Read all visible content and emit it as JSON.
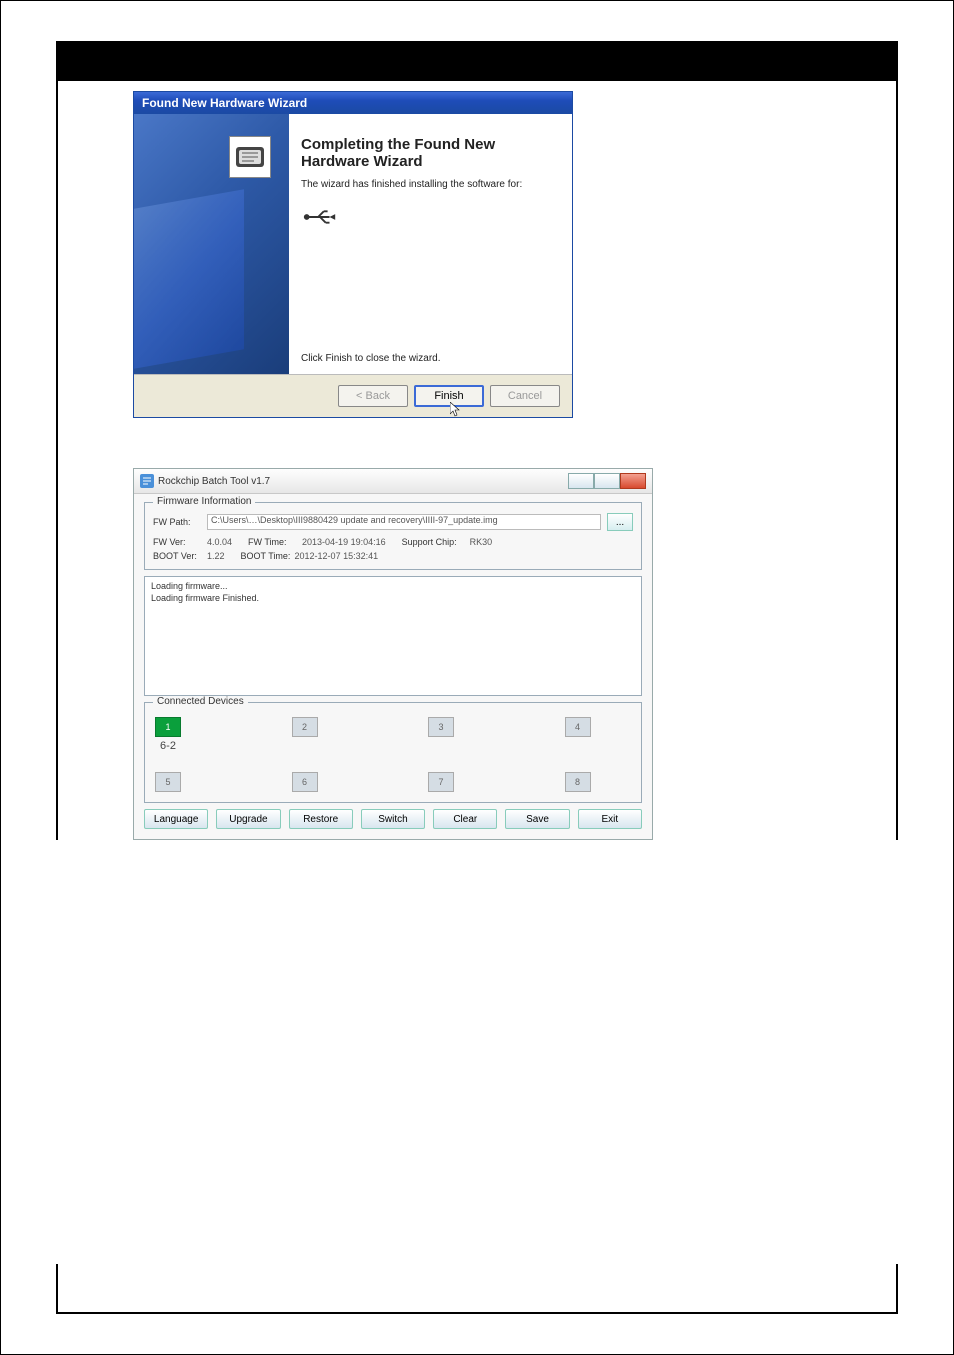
{
  "wizard": {
    "title": "Found New Hardware Wizard",
    "heading": "Completing the Found New Hardware Wizard",
    "sub": "The wizard has finished installing the software for:",
    "close_text": "Click Finish to close the wizard.",
    "back": "< Back",
    "finish": "Finish",
    "cancel": "Cancel"
  },
  "rk": {
    "title": "Rockchip Batch Tool v1.7",
    "fwinfo_legend": "Firmware Information",
    "fw_path_label": "FW Path:",
    "fw_path_value": "C:\\Users\\…\\Desktop\\III9880429 update and recovery\\IIII-97_update.img",
    "browse": "...",
    "fw_ver_label": "FW Ver:",
    "fw_ver_value": "4.0.04",
    "fw_time_label": "FW Time:",
    "fw_time_value": "2013-04-19 19:04:16",
    "support_chip_label": "Support Chip:",
    "support_chip_value": "RK30",
    "boot_ver_label": "BOOT Ver:",
    "boot_ver_value": "1.22",
    "boot_time_label": "BOOT Time:",
    "boot_time_value": "2012-12-07 15:32:41",
    "log_line1": "Loading firmware...",
    "log_line2": "Loading firmware Finished.",
    "devices_legend": "Connected Devices",
    "dev_slots": [
      "1",
      "2",
      "3",
      "4",
      "5",
      "6",
      "7",
      "8"
    ],
    "dev_sub": "6-2",
    "buttons": {
      "language": "Language",
      "upgrade": "Upgrade",
      "restore": "Restore",
      "switch": "Switch",
      "clear": "Clear",
      "save": "Save",
      "exit": "Exit"
    }
  }
}
